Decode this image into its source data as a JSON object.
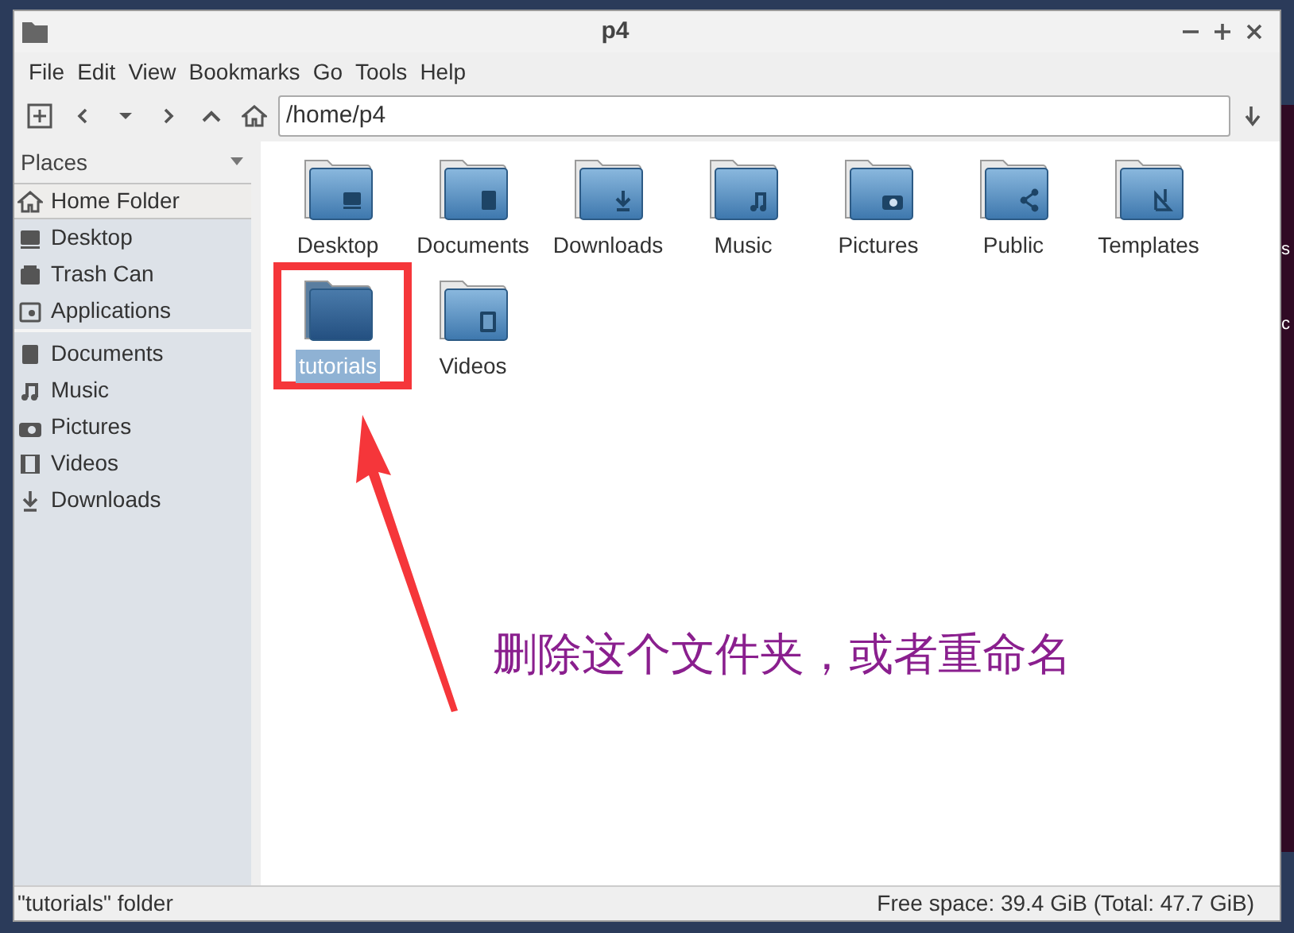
{
  "window": {
    "title": "p4"
  },
  "menu": [
    "File",
    "Edit",
    "View",
    "Bookmarks",
    "Go",
    "Tools",
    "Help"
  ],
  "location": {
    "value": "/home/p4"
  },
  "sidebar": {
    "title": "Places",
    "groups": [
      [
        {
          "label": "Home Folder",
          "kind": "home",
          "selected": true
        },
        {
          "label": "Desktop",
          "kind": "desktop",
          "selected": false
        },
        {
          "label": "Trash Can",
          "kind": "trash",
          "selected": false
        },
        {
          "label": "Applications",
          "kind": "apps",
          "selected": false
        }
      ],
      [
        {
          "label": "Documents",
          "kind": "documents",
          "selected": false
        },
        {
          "label": "Music",
          "kind": "music",
          "selected": false
        },
        {
          "label": "Pictures",
          "kind": "pictures",
          "selected": false
        },
        {
          "label": "Videos",
          "kind": "videos",
          "selected": false
        },
        {
          "label": "Downloads",
          "kind": "downloads",
          "selected": false
        }
      ]
    ]
  },
  "files": [
    {
      "name": "Desktop",
      "kind": "desktop",
      "selected": false
    },
    {
      "name": "Documents",
      "kind": "documents",
      "selected": false
    },
    {
      "name": "Downloads",
      "kind": "downloads",
      "selected": false
    },
    {
      "name": "Music",
      "kind": "music",
      "selected": false
    },
    {
      "name": "Pictures",
      "kind": "pictures",
      "selected": false
    },
    {
      "name": "Public",
      "kind": "public",
      "selected": false
    },
    {
      "name": "Templates",
      "kind": "templates",
      "selected": false
    },
    {
      "name": "tutorials",
      "kind": "plain",
      "selected": true
    },
    {
      "name": "Videos",
      "kind": "videos",
      "selected": false
    }
  ],
  "annotation": {
    "text": "删除这个文件夹，或者重命名"
  },
  "status_bar": {
    "left": "\"tutorials\" folder",
    "right": "Free space: 39.4 GiB (Total: 47.7 GiB)"
  },
  "background_window": {
    "lines": [
      "s",
      "c"
    ]
  }
}
